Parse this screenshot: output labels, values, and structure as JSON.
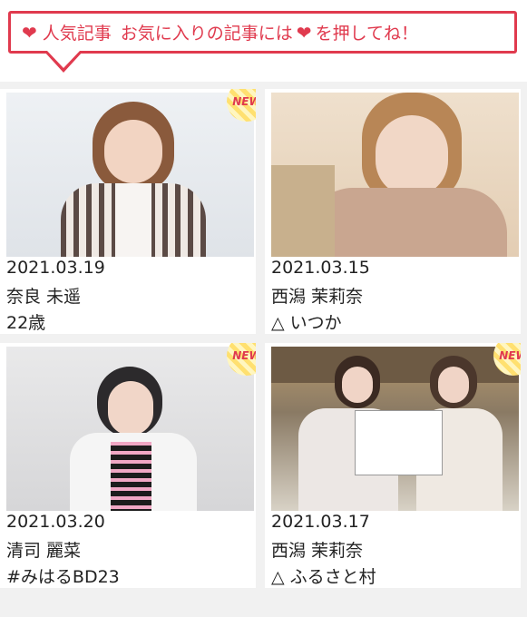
{
  "banner": {
    "title": "人気記事",
    "message_part1": "お気に入りの記事には",
    "message_part2": "を押してね！",
    "heart_icon": "heart-icon",
    "accent_color": "#e03a4e"
  },
  "badge_label": "NEW",
  "articles": [
    {
      "date": "2021.03.19",
      "name": "奈良 未遥",
      "subtitle": "22歳",
      "is_new": true
    },
    {
      "date": "2021.03.15",
      "name": "西潟 茉莉奈",
      "subtitle": "△ いつか",
      "is_new": false
    },
    {
      "date": "2021.03.20",
      "name": "清司 麗菜",
      "subtitle": "#みはるBD23",
      "is_new": true
    },
    {
      "date": "2021.03.17",
      "name": "西潟 茉莉奈",
      "subtitle": "△ ふるさと村",
      "is_new": true
    }
  ]
}
